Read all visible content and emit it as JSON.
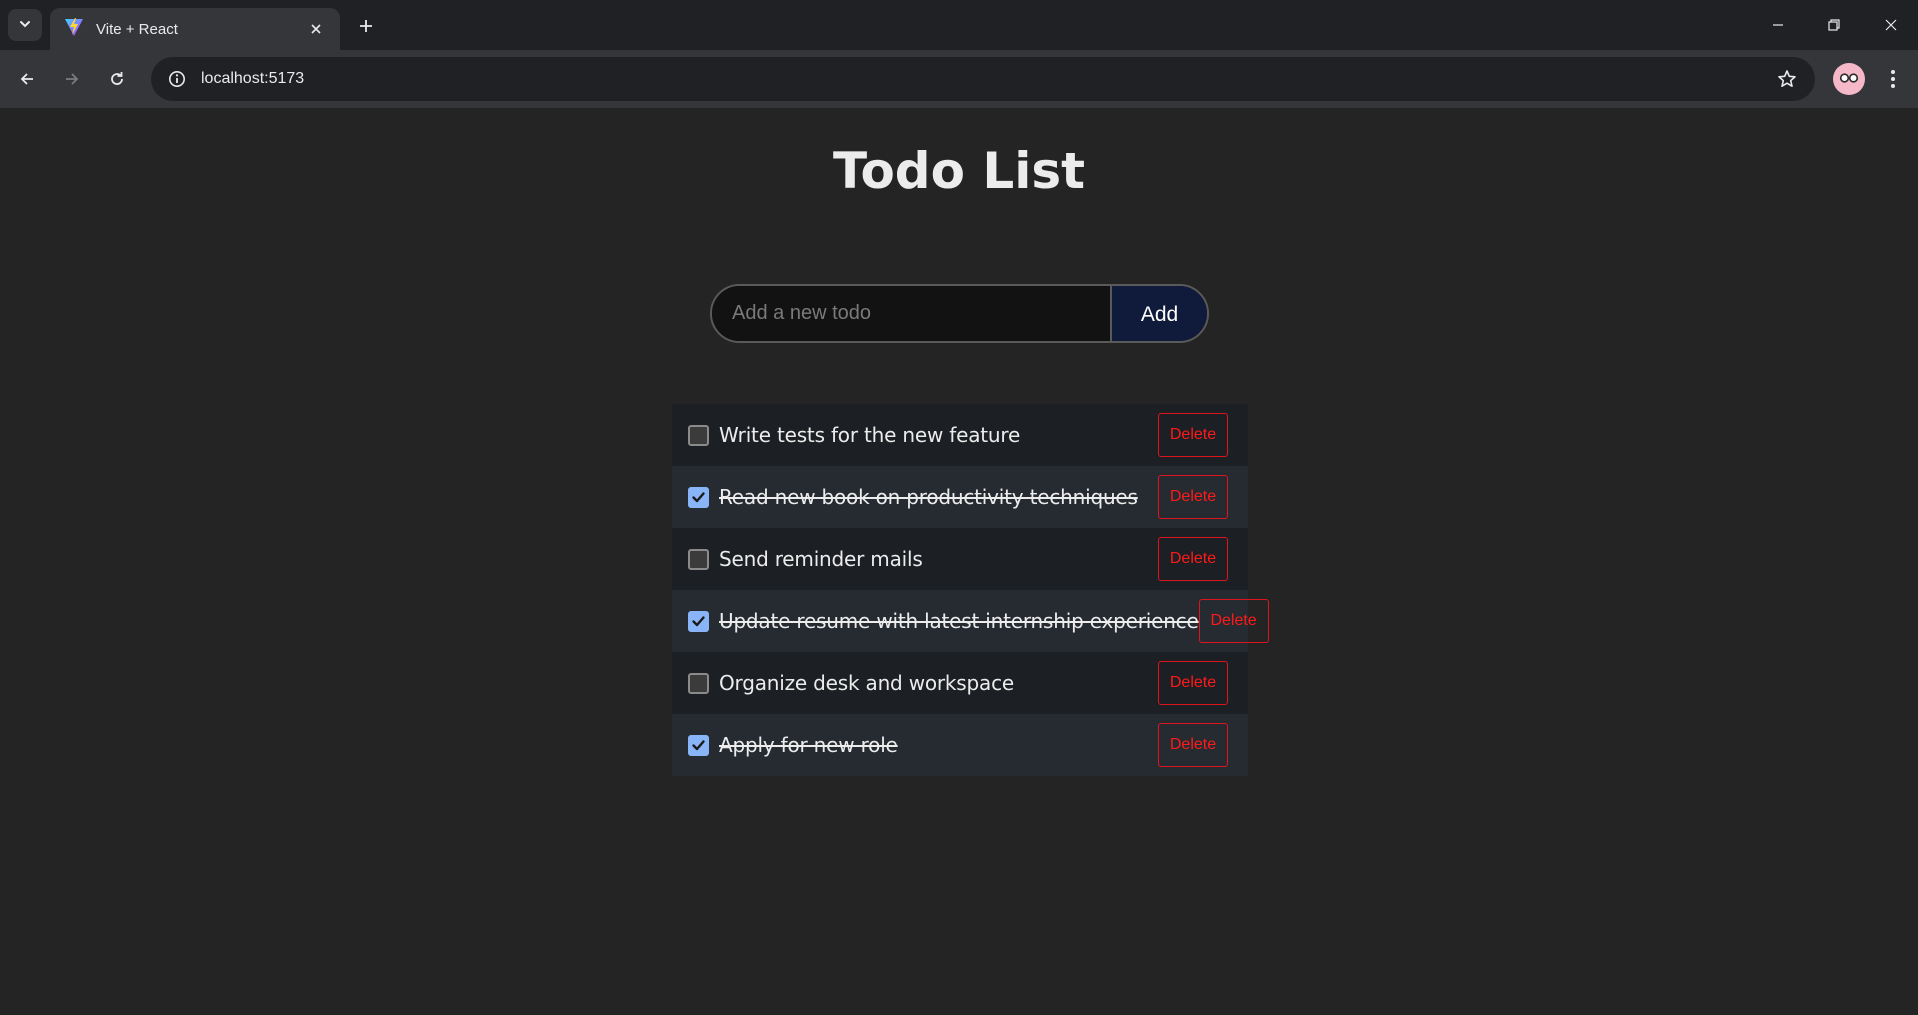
{
  "browser": {
    "tab_title": "Vite + React",
    "url": "localhost:5173",
    "icons": {
      "tab_list": "chevron-down-icon",
      "favicon": "vite-logo-icon",
      "tab_close": "close-icon",
      "new_tab": "plus-icon",
      "minimize": "minimize-icon",
      "restore": "restore-icon",
      "close_window": "close-icon",
      "back": "back-arrow-icon",
      "forward": "forward-arrow-icon",
      "reload": "reload-icon",
      "site_info": "info-icon",
      "bookmark": "star-icon",
      "profile": "avatar-icon",
      "menu": "kebab-menu-icon"
    }
  },
  "app": {
    "title": "Todo List",
    "input": {
      "value": "",
      "placeholder": "Add a new todo"
    },
    "add_label": "Add",
    "delete_label": "Delete",
    "todos": [
      {
        "text": "Write tests for the new feature",
        "completed": false
      },
      {
        "text": "Read new book on productivity techniques",
        "completed": true
      },
      {
        "text": "Send reminder mails",
        "completed": false
      },
      {
        "text": "Update resume with latest internship experience",
        "completed": true
      },
      {
        "text": "Organize desk and workspace",
        "completed": false
      },
      {
        "text": "Apply for new role",
        "completed": true
      }
    ]
  },
  "colors": {
    "background": "#242424",
    "accent_checkbox": "#8ab4f8",
    "delete_red": "#ff1a1a",
    "add_button": "#101a3a"
  }
}
